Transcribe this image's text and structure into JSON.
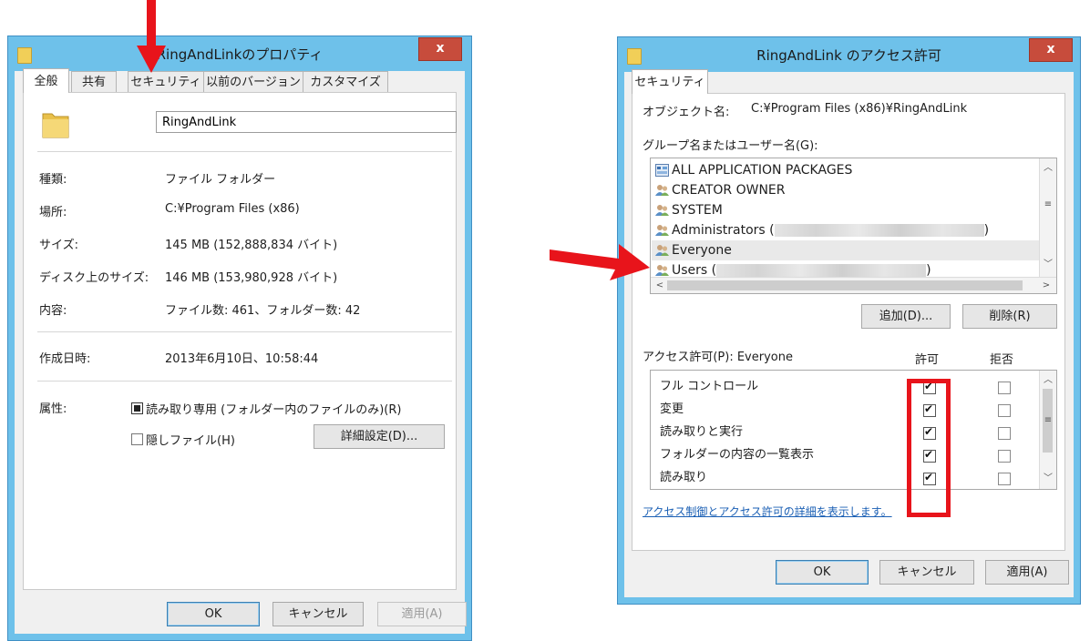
{
  "properties_window": {
    "title": "RingAndLinkのプロパティ",
    "close_label": "x",
    "tabs": [
      "全般",
      "共有",
      "セキュリティ",
      "以前のバージョン",
      "カスタマイズ"
    ],
    "active_tab": "全般",
    "folder_name": "RingAndLink",
    "fields": {
      "type_label": "種類:",
      "type_value": "ファイル フォルダー",
      "location_label": "場所:",
      "location_value": "C:¥Program Files (x86)",
      "size_label": "サイズ:",
      "size_value": "145 MB (152,888,834 バイト)",
      "disk_size_label": "ディスク上のサイズ:",
      "disk_size_value": "146 MB (153,980,928 バイト)",
      "contents_label": "内容:",
      "contents_value": "ファイル数: 461、フォルダー数: 42",
      "created_label": "作成日時:",
      "created_value": "2013年6月10日、10:58:44",
      "attributes_label": "属性:"
    },
    "readonly_label": "読み取り専用 (フォルダー内のファイルのみ)(R)",
    "hidden_label": "隠しファイル(H)",
    "advanced_button": "詳細設定(D)...",
    "ok": "OK",
    "cancel": "キャンセル",
    "apply": "適用(A)"
  },
  "permissions_window": {
    "title": "RingAndLink のアクセス許可",
    "close_label": "x",
    "tab": "セキュリティ",
    "object_label": "オブジェクト名:",
    "object_value": "C:¥Program Files (x86)¥RingAndLink",
    "group_label": "グループ名またはユーザー名(G):",
    "users": [
      {
        "name": "ALL APPLICATION PACKAGES",
        "icon": "app-packages-icon"
      },
      {
        "name": "CREATOR OWNER",
        "icon": "users-icon"
      },
      {
        "name": "SYSTEM",
        "icon": "users-icon"
      },
      {
        "name": "Administrators (",
        "suffix": ")",
        "icon": "users-icon"
      },
      {
        "name": "Everyone",
        "icon": "users-icon",
        "selected": true
      },
      {
        "name": "Users (",
        "suffix": ")",
        "icon": "users-icon"
      }
    ],
    "add_button": "追加(D)...",
    "remove_button": "削除(R)",
    "perm_label": "アクセス許可(P): Everyone",
    "allow_header": "許可",
    "deny_header": "拒否",
    "permissions": [
      {
        "name": "フル コントロール",
        "allow": true,
        "deny": false
      },
      {
        "name": "変更",
        "allow": true,
        "deny": false
      },
      {
        "name": "読み取りと実行",
        "allow": true,
        "deny": false
      },
      {
        "name": "フォルダーの内容の一覧表示",
        "allow": true,
        "deny": false
      },
      {
        "name": "読み取り",
        "allow": true,
        "deny": false
      }
    ],
    "details_link": "アクセス制御とアクセス許可の詳細を表示します。",
    "ok": "OK",
    "cancel": "キャンセル",
    "apply": "適用(A)"
  },
  "annotation_color": "#e8141b"
}
